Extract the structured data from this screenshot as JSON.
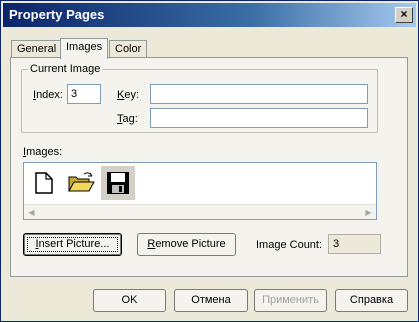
{
  "window": {
    "title": "Property Pages",
    "close_label": "×"
  },
  "tabs": [
    {
      "label": "General"
    },
    {
      "label": "Images"
    },
    {
      "label": "Color"
    }
  ],
  "current_image": {
    "group_label": "Current Image",
    "index_label_prefix": "I",
    "index_label_rest": "ndex:",
    "index_value": "3",
    "key_label_prefix": "K",
    "key_label_rest": "ey:",
    "key_value": "",
    "tag_label_prefix": "T",
    "tag_label_rest": "ag:",
    "tag_value": ""
  },
  "images": {
    "label_prefix": "I",
    "label_rest": "mages:",
    "items": [
      {
        "icon": "blank-document-icon"
      },
      {
        "icon": "open-folder-icon"
      },
      {
        "icon": "floppy-disk-icon"
      }
    ]
  },
  "actions": {
    "insert_prefix": "I",
    "insert_rest": "nsert Picture...",
    "remove_prefix": "R",
    "remove_rest": "emove Picture",
    "count_label": "Image Count:",
    "count_value": "3"
  },
  "dialog_buttons": {
    "ok": "OK",
    "cancel": "Отмена",
    "apply": "Применить",
    "help": "Справка"
  }
}
